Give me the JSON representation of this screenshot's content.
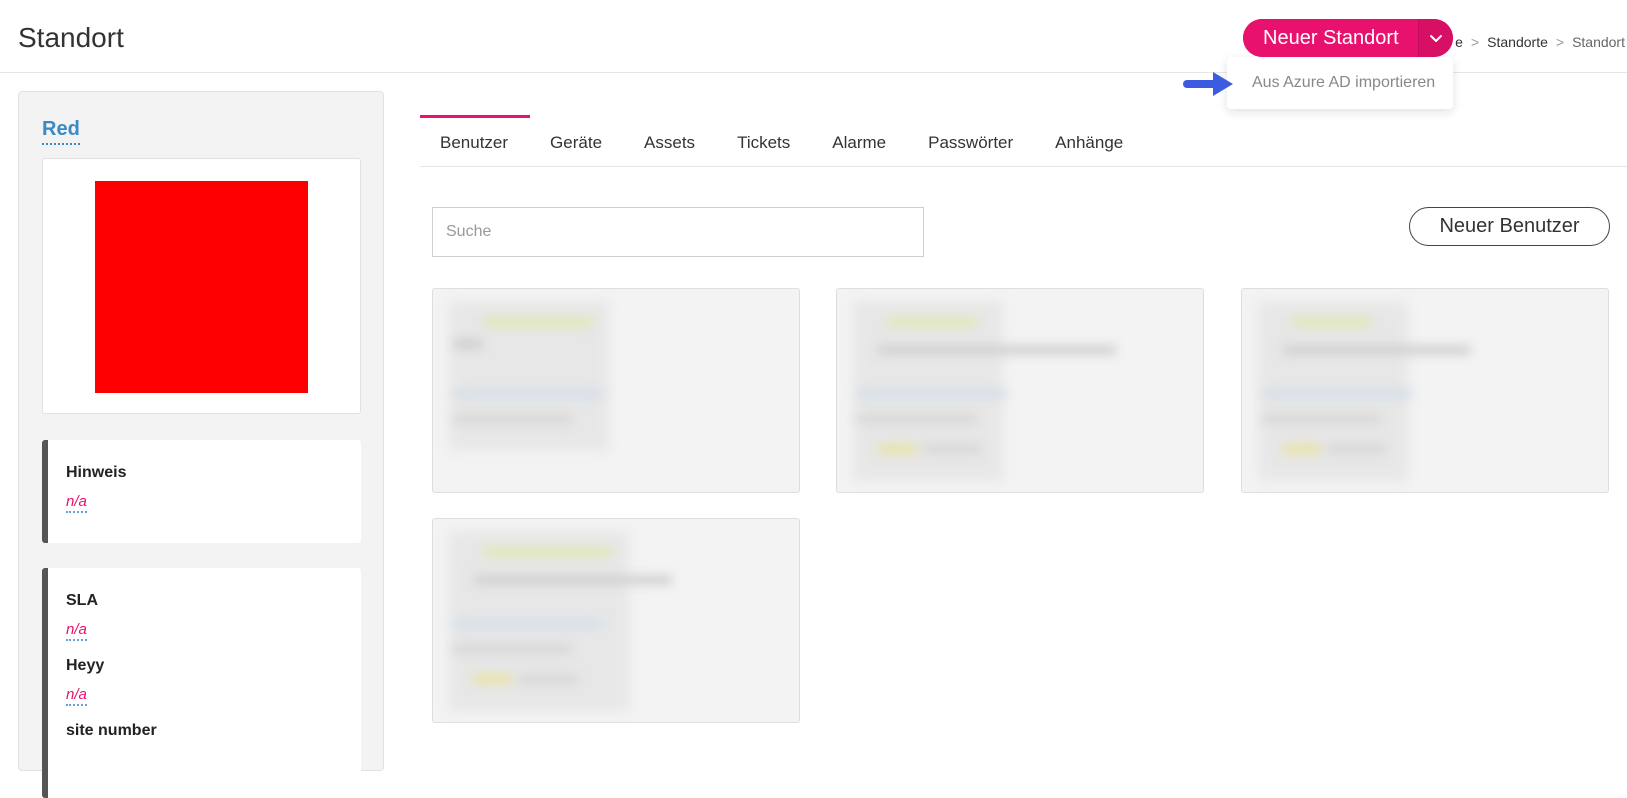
{
  "header": {
    "title": "Standort",
    "split_button_label": "Neuer Standort",
    "breadcrumb": [
      "e",
      "Standorte",
      "Standort"
    ]
  },
  "dropdown": {
    "items": [
      "Aus Azure AD importieren"
    ]
  },
  "sidebar": {
    "site_name": "Red",
    "note_card": {
      "label": "Hinweis",
      "value": "n/a"
    },
    "fields": [
      {
        "label": "SLA",
        "value": "n/a"
      },
      {
        "label": "Heyy",
        "value": "n/a"
      },
      {
        "label": "site number"
      }
    ]
  },
  "tabs": [
    "Benutzer",
    "Geräte",
    "Assets",
    "Tickets",
    "Alarme",
    "Passwörter",
    "Anhänge"
  ],
  "search": {
    "placeholder": "Suche"
  },
  "new_user_label": "Neuer Benutzer",
  "colors": {
    "accent": "#e8116e",
    "link": "#3a8ac5",
    "arrow": "#3b5be0",
    "site_image": "#ff0000"
  }
}
